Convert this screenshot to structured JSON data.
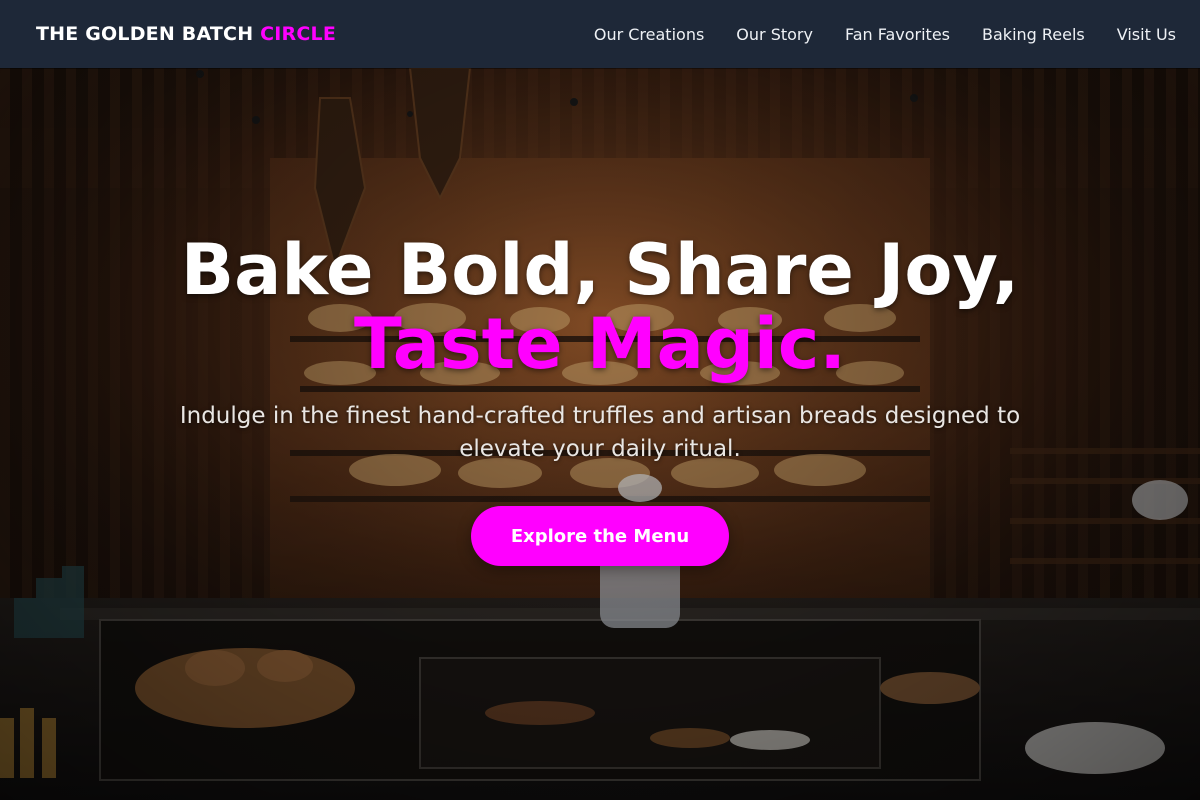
{
  "brand": {
    "name": "THE GOLDEN BATCH",
    "accent": "CIRCLE"
  },
  "nav": {
    "links": [
      {
        "label": "Our Creations"
      },
      {
        "label": "Our Story"
      },
      {
        "label": "Fan Favorites"
      },
      {
        "label": "Baking Reels"
      },
      {
        "label": "Visit Us"
      }
    ]
  },
  "hero": {
    "headline_line1": "Bake Bold, Share Joy,",
    "headline_line2": "Taste Magic.",
    "subtitle": "Indulge in the finest hand-crafted truffles and artisan breads designed to elevate your daily ritual.",
    "cta_label": "Explore the Menu",
    "background": "bakery-interior-photo"
  },
  "colors": {
    "accent": "#ff00ff",
    "navbar_bg": "#1e2838",
    "text": "#ffffff"
  }
}
